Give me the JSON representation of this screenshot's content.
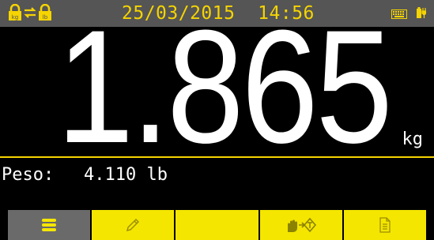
{
  "status": {
    "datetime": "25/03/2015  14:56",
    "left_icons": [
      "lock-kg-icon",
      "swap-units-icon",
      "lock-lb-icon"
    ],
    "right_icons": [
      "keyboard-icon",
      "battery-plug-icon"
    ]
  },
  "display": {
    "weight": "1.865",
    "unit": "kg",
    "secondary_label": "Peso:",
    "secondary_value": "4.110 lb"
  },
  "function_keys": [
    {
      "icon": "menu-icon",
      "active": true
    },
    {
      "icon": "pencil-icon",
      "active": false
    },
    {
      "icon": "",
      "active": false
    },
    {
      "icon": "hand-transfer-icon",
      "active": false
    },
    {
      "icon": "document-icon",
      "active": false
    }
  ],
  "colors": {
    "accent_yellow": "#f5e600",
    "status_bar": "#555555",
    "background": "#000000",
    "text": "#ffffff"
  }
}
